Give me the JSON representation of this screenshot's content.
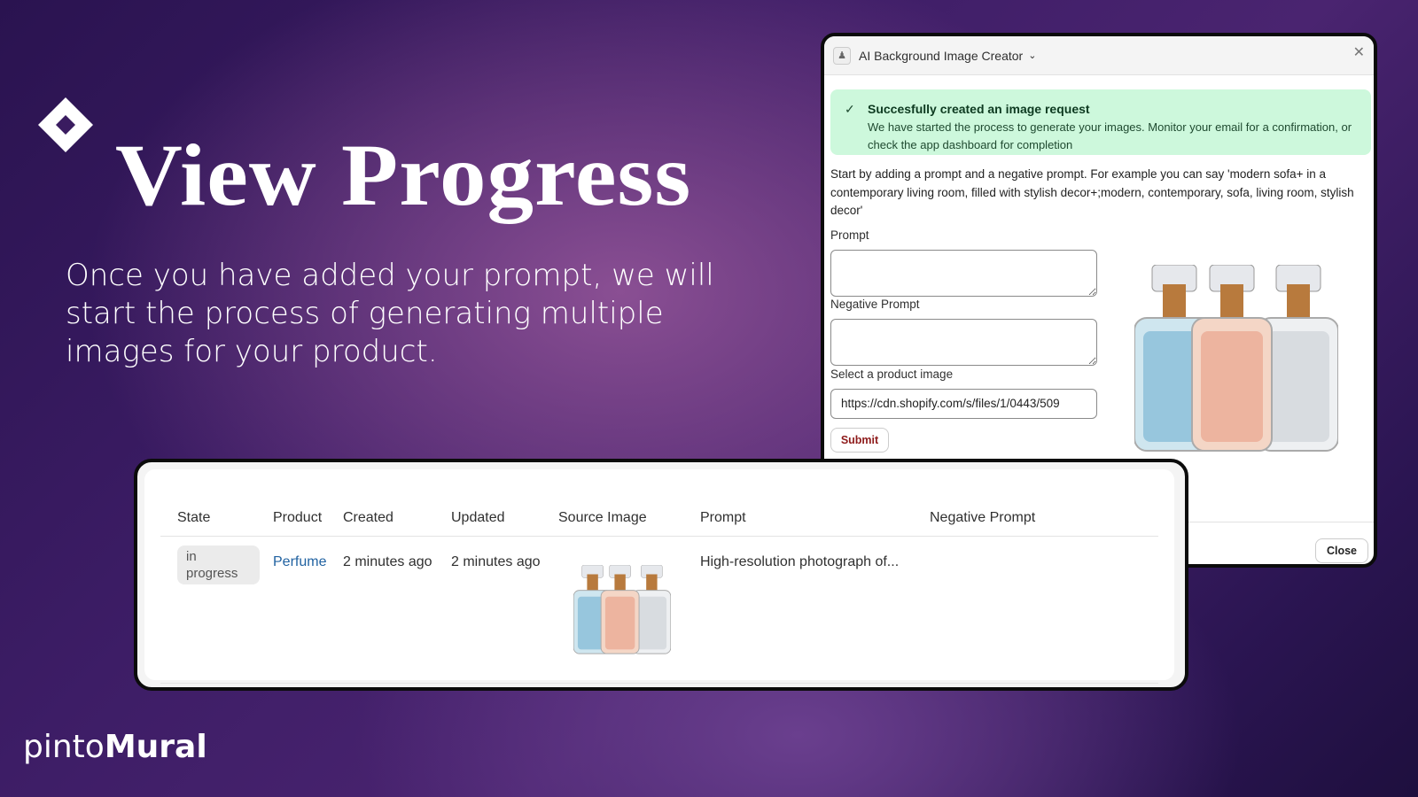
{
  "hero": {
    "title": "View Progress",
    "intro": "Once you have added your prompt, we will start the process of generating multiple images for your product.",
    "logo_icon": "diamond-icon"
  },
  "brand": {
    "light": "pinto",
    "bold": "Mural"
  },
  "dialog": {
    "app_name": "AI Background Image Creator",
    "banner": {
      "title": "Succesfully created an image request",
      "message": "We have started the process to generate your images. Monitor your email for a confirmation, or check the app dashboard for completion",
      "color": "#cdf8dc"
    },
    "instructions": "Start by adding a prompt and a negative prompt. For example you can say 'modern sofa+ in a contemporary living room, filled with stylish decor+;modern, contemporary, sofa, living room, stylish decor'",
    "prompt_label": "Prompt",
    "prompt_value": "",
    "negative_label": "Negative Prompt",
    "negative_value": "",
    "image_label": "Select a product image",
    "image_value": "https://cdn.shopify.com/s/files/1/0443/509",
    "submit": "Submit",
    "close": "Close"
  },
  "table": {
    "headers": [
      "State",
      "Product",
      "Created",
      "Updated",
      "Source Image",
      "Prompt",
      "Negative Prompt"
    ],
    "rows": [
      {
        "state": "in progress",
        "product": "Perfume",
        "created": "2 minutes ago",
        "updated": "2 minutes ago",
        "prompt": "High-resolution photograph of...",
        "negative": ""
      }
    ]
  }
}
